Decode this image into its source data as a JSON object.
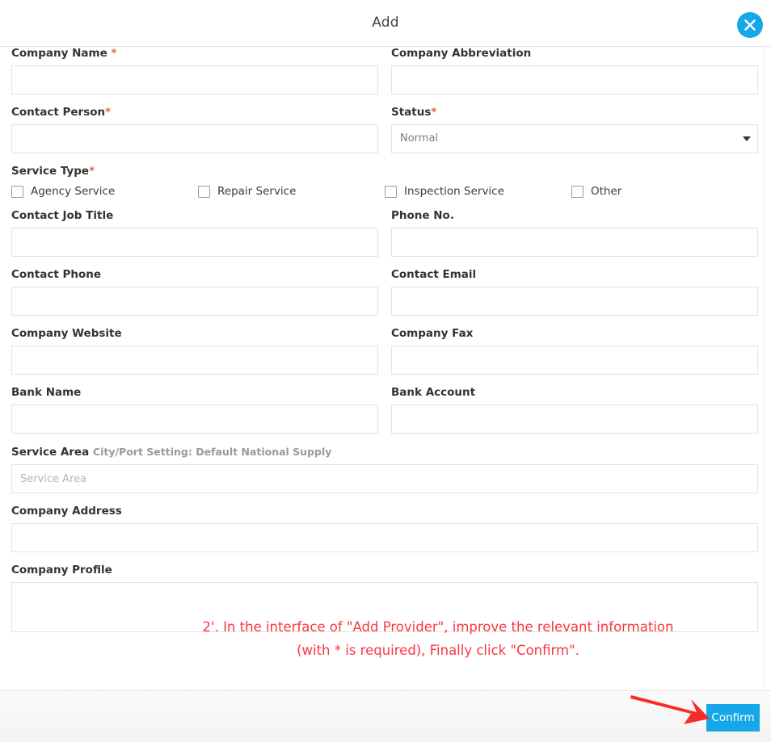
{
  "header": {
    "title": "Add",
    "close_icon": "close-icon"
  },
  "form": {
    "fields": [
      {
        "id": "company-name",
        "label": "Company Name ",
        "required": true,
        "value": "",
        "placeholder": "",
        "type": "text",
        "column": "left"
      },
      {
        "id": "company-abbreviation",
        "label": "Company Abbreviation",
        "required": false,
        "value": "",
        "placeholder": "",
        "type": "text",
        "column": "right"
      },
      {
        "id": "contact-person",
        "label": "Contact Person",
        "required": true,
        "value": "",
        "placeholder": "",
        "type": "text",
        "column": "left"
      },
      {
        "id": "status",
        "label": "Status",
        "required": true,
        "value": "Normal",
        "type": "select",
        "column": "right"
      },
      {
        "id": "contact-job-title",
        "label": "Contact Job Title",
        "required": false,
        "value": "",
        "placeholder": "",
        "type": "text",
        "column": "left"
      },
      {
        "id": "phone-no",
        "label": "Phone No.",
        "required": false,
        "value": "",
        "placeholder": "",
        "type": "text",
        "column": "right"
      },
      {
        "id": "contact-phone",
        "label": "Contact Phone",
        "required": false,
        "value": "",
        "placeholder": "",
        "type": "text",
        "column": "left"
      },
      {
        "id": "contact-email",
        "label": "Contact Email",
        "required": false,
        "value": "",
        "placeholder": "",
        "type": "text",
        "column": "right"
      },
      {
        "id": "company-website",
        "label": "Company Website",
        "required": false,
        "value": "",
        "placeholder": "",
        "type": "text",
        "column": "left"
      },
      {
        "id": "company-fax",
        "label": "Company Fax",
        "required": false,
        "value": "",
        "placeholder": "",
        "type": "text",
        "column": "right"
      },
      {
        "id": "bank-name",
        "label": "Bank Name",
        "required": false,
        "value": "",
        "placeholder": "",
        "type": "text",
        "column": "left"
      },
      {
        "id": "bank-account",
        "label": "Bank Account",
        "required": false,
        "value": "",
        "placeholder": "",
        "type": "text",
        "column": "right"
      }
    ],
    "labels": {
      "company_name": "Company Name ",
      "company_abbreviation": "Company Abbreviation",
      "contact_person": "Contact Person",
      "status": "Status",
      "service_type": "Service Type",
      "contact_job_title": "Contact Job Title",
      "phone_no": "Phone No.",
      "contact_phone": "Contact Phone",
      "contact_email": "Contact Email",
      "company_website": "Company Website",
      "company_fax": "Company Fax",
      "bank_name": "Bank Name",
      "bank_account": "Bank Account",
      "service_area": "Service Area",
      "service_area_hint": "City/Port Setting: Default National Supply",
      "company_address": "Company Address",
      "company_profile": "Company Profile"
    },
    "required_marker": "*",
    "status": {
      "selected": "Normal",
      "options": [
        "Normal"
      ],
      "caret_icon": "chevron-down-icon"
    },
    "service_type": {
      "options": [
        {
          "label": "Agency Service",
          "checked": false
        },
        {
          "label": "Repair Service",
          "checked": false
        },
        {
          "label": "Inspection Service",
          "checked": false
        },
        {
          "label": "Other",
          "checked": false
        }
      ]
    },
    "service_area": {
      "placeholder": "Service Area",
      "value": ""
    },
    "company_address": {
      "value": "",
      "placeholder": ""
    },
    "company_profile": {
      "value": "",
      "placeholder": ""
    }
  },
  "footer": {
    "confirm_label": "Confirm"
  },
  "annotation": {
    "text": "2'. In the interface of \"Add Provider\", improve the relevant information\n(with * is required), Finally click \"Confirm\".",
    "color": "#fb3640",
    "arrow": "red-arrow-pointing-to-confirm"
  },
  "colors": {
    "accent": "#16a7e8",
    "required": "#e8604c",
    "annotation": "#fb3640",
    "border": "#e2e2e2",
    "label": "#333333",
    "hint": "#9a9a9a"
  }
}
